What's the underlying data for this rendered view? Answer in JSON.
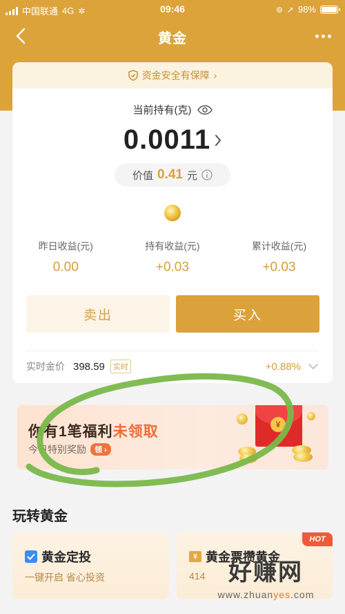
{
  "status_bar": {
    "carrier": "中国联通",
    "network": "4G",
    "time": "09:46",
    "battery": "98%",
    "battery_level": 0.98
  },
  "nav": {
    "title": "黄金"
  },
  "card": {
    "safety_text": "资金安全有保障",
    "holding_label": "当前持有(克)",
    "holding_value": "0.0011",
    "value_label": "价值",
    "value_amount": "0.41",
    "value_unit": "元",
    "stats": [
      {
        "label": "昨日收益(元)",
        "value": "0.00"
      },
      {
        "label": "持有收益(元)",
        "value": "+0.03"
      },
      {
        "label": "累计收益(元)",
        "value": "+0.03"
      }
    ],
    "sell_label": "卖出",
    "buy_label": "买入",
    "realtime_price_label": "实时金价",
    "realtime_price_value": "398.59",
    "realtime_tag": "实时",
    "price_change": "+0.88%"
  },
  "promo": {
    "title_prefix": "你有1笔福利",
    "title_highlight": "未领取",
    "subtitle": "今日特别奖励",
    "claim_label": "领"
  },
  "section": {
    "title": "玩转黄金",
    "cards": [
      {
        "title": "黄金定投",
        "subtitle": "一键开启 省心投资"
      },
      {
        "title": "黄金票攒黄金",
        "subtitle": "414",
        "badge": "HOT"
      }
    ]
  },
  "watermark": {
    "text": "好赚网",
    "url_prefix": "www.zhuan",
    "url_highlight": "yes",
    "url_suffix": ".com"
  },
  "colors": {
    "brand_gold": "#dca33a",
    "accent_orange": "#ef6b32",
    "scribble_green": "#79b84a"
  }
}
